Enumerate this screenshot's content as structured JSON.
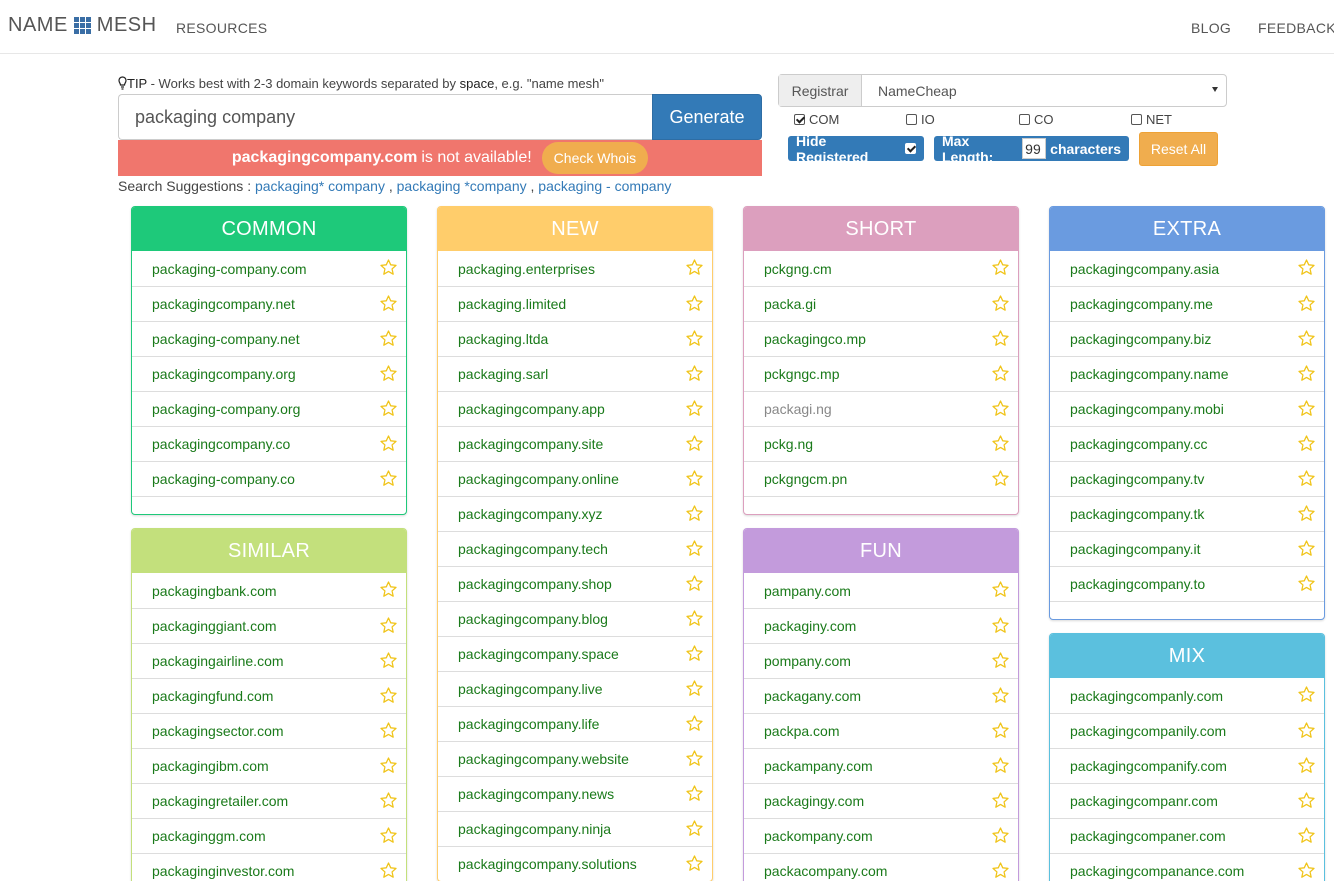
{
  "colors": {
    "rainbow": [
      "#f0ad4e",
      "#5cb85c",
      "#d9534f",
      "#337ab7",
      "#9b59b6",
      "#5bc0de",
      "#e0e0e0",
      "#e0e0e0"
    ],
    "primary": "#337ab7",
    "warning": "#f0ad4e",
    "alert": "#f0766d",
    "domain_text": "#1a7a1a",
    "star": "#f0c419"
  },
  "header": {
    "logo_left": "NAME",
    "logo_right": "MESH",
    "logo_icon": "grid-icon",
    "resources": "RESOURCES",
    "blog": "BLOG",
    "feedback": "FEEDBACK"
  },
  "search": {
    "tip_prefix": "TIP",
    "tip_text": " - Works best with 2-3 domain keywords separated by ",
    "tip_bold": "space",
    "tip_suffix": ", e.g. \"name mesh\"",
    "value": "packaging company",
    "generate_label": "Generate",
    "alert_domain": "packagingcompany.com",
    "alert_text": "is not available!",
    "check_whois_label": "Check Whois",
    "suggest_label": "Search Suggestions :",
    "suggestions": [
      "packaging* company",
      "packaging *company",
      "packaging - company"
    ]
  },
  "options": {
    "registrar_label": "Registrar",
    "registrar_value": "NameCheap",
    "tlds": [
      {
        "label": "COM",
        "checked": true
      },
      {
        "label": "IO",
        "checked": false
      },
      {
        "label": "CO",
        "checked": false
      },
      {
        "label": "NET",
        "checked": false
      }
    ],
    "hide_registered_label": "Hide Registered",
    "max_length_label": "Max Length:",
    "max_length_value": "99",
    "characters_label": "characters",
    "reset_label": "Reset All"
  },
  "panels": {
    "common": {
      "title": "COMMON",
      "color": "#1ec97a",
      "domains": [
        "packaging-company.com",
        "packagingcompany.net",
        "packaging-company.net",
        "packagingcompany.org",
        "packaging-company.org",
        "packagingcompany.co",
        "packaging-company.co"
      ]
    },
    "similar": {
      "title": "SIMILAR",
      "color": "#c3e07c",
      "domains": [
        "packagingbank.com",
        "packaginggiant.com",
        "packagingairline.com",
        "packagingfund.com",
        "packagingsector.com",
        "packagingibm.com",
        "packagingretailer.com",
        "packaginggm.com",
        "packaginginvestor.com"
      ]
    },
    "new": {
      "title": "NEW",
      "color": "#ffcd6b",
      "domains": [
        "packaging.enterprises",
        "packaging.limited",
        "packaging.ltda",
        "packaging.sarl",
        "packagingcompany.app",
        "packagingcompany.site",
        "packagingcompany.online",
        "packagingcompany.xyz",
        "packagingcompany.tech",
        "packagingcompany.shop",
        "packagingcompany.blog",
        "packagingcompany.space",
        "packagingcompany.live",
        "packagingcompany.life",
        "packagingcompany.website",
        "packagingcompany.news",
        "packagingcompany.ninja",
        "packagingcompany.solutions"
      ]
    },
    "short": {
      "title": "SHORT",
      "color": "#dc9fbe",
      "domains": [
        "pckgng.cm",
        "packa.gi",
        "packagingco.mp",
        "pckgngc.mp",
        "packagi.ng",
        "pckg.ng",
        "pckgngcm.pn"
      ],
      "greyed": [
        4
      ]
    },
    "fun": {
      "title": "FUN",
      "color": "#c39bdc",
      "domains": [
        "pampany.com",
        "packaginy.com",
        "pompany.com",
        "packagany.com",
        "packpa.com",
        "packampany.com",
        "packagingy.com",
        "packompany.com",
        "packacompany.com"
      ]
    },
    "extra": {
      "title": "EXTRA",
      "color": "#6a9be0",
      "domains": [
        "packagingcompany.asia",
        "packagingcompany.me",
        "packagingcompany.biz",
        "packagingcompany.name",
        "packagingcompany.mobi",
        "packagingcompany.cc",
        "packagingcompany.tv",
        "packagingcompany.tk",
        "packagingcompany.it",
        "packagingcompany.to"
      ]
    },
    "mix": {
      "title": "MIX",
      "color": "#5bc0de",
      "domains": [
        "packagingcompanly.com",
        "packagingcompanily.com",
        "packagingcompanify.com",
        "packagingcompanr.com",
        "packagingcompaner.com",
        "packagingcompanance.com"
      ]
    }
  }
}
